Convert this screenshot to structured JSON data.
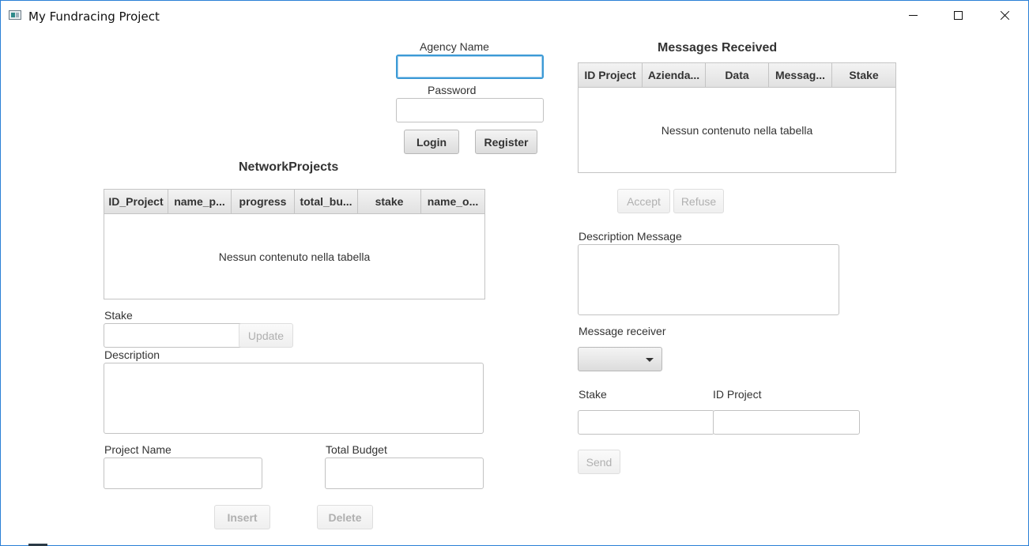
{
  "window": {
    "title": "My Fundracing Project"
  },
  "login": {
    "agency_name_label": "Agency Name",
    "password_label": "Password",
    "agency_name_value": "",
    "password_value": "",
    "login_button": "Login",
    "register_button": "Register"
  },
  "network_projects": {
    "title": "NetworkProjects",
    "columns": [
      "ID_Project",
      "name_p...",
      "progress",
      "total_bu...",
      "stake",
      "name_o..."
    ],
    "empty_text": "Nessun contenuto nella tabella",
    "stake_label": "Stake",
    "stake_value": "",
    "update_button": "Update",
    "description_label": "Description",
    "description_value": "",
    "project_name_label": "Project Name",
    "project_name_value": "",
    "total_budget_label": "Total Budget",
    "total_budget_value": "",
    "insert_button": "Insert",
    "delete_button": "Delete"
  },
  "messages": {
    "title": "Messages Received",
    "columns": [
      "ID Project",
      "Azienda...",
      "Data",
      "Messag...",
      "Stake"
    ],
    "empty_text": "Nessun contenuto nella tabella",
    "accept_button": "Accept",
    "refuse_button": "Refuse",
    "description_message_label": "Description Message",
    "description_message_value": "",
    "message_receiver_label": "Message receiver",
    "message_receiver_value": "",
    "stake_label": "Stake",
    "stake_value": "",
    "id_project_label": "ID Project",
    "id_project_value": "",
    "send_button": "Send"
  }
}
